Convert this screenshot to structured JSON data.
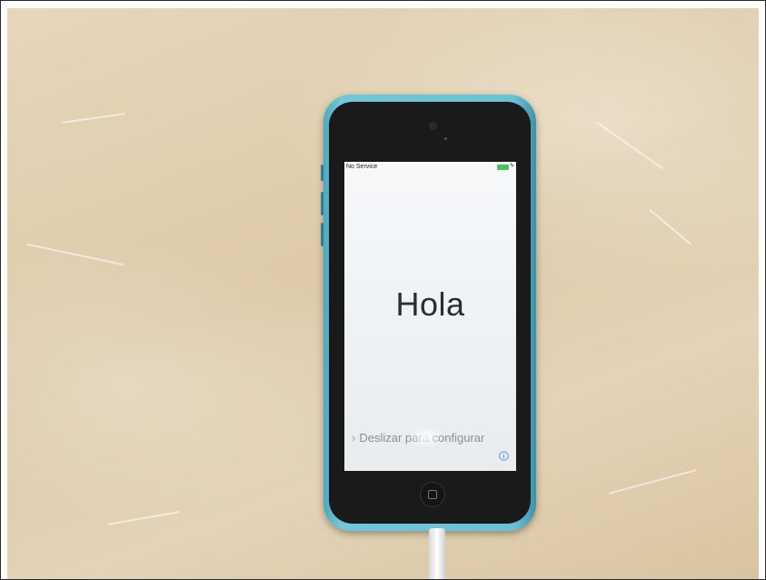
{
  "status_bar": {
    "carrier": "No Service"
  },
  "welcome": {
    "greeting": "Hola",
    "slide_text": "Deslizar para configurar"
  },
  "colors": {
    "phone_body": "#6ac1d4",
    "battery": "#46c35a",
    "screen": "#f2f4f6"
  },
  "icons": {
    "chevron": "chevron-right-icon",
    "info": "info-icon",
    "home": "home-button-icon"
  }
}
